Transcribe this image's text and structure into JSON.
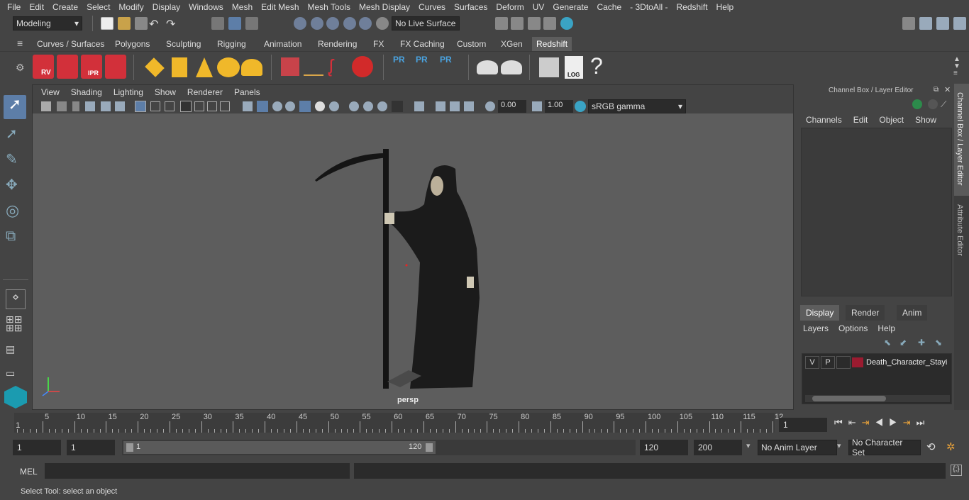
{
  "menubar": [
    "File",
    "Edit",
    "Create",
    "Select",
    "Modify",
    "Display",
    "Windows",
    "Mesh",
    "Edit Mesh",
    "Mesh Tools",
    "Mesh Display",
    "Curves",
    "Surfaces",
    "Deform",
    "UV",
    "Generate",
    "Cache",
    "- 3DtoAll -",
    "Redshift",
    "Help"
  ],
  "status": {
    "mode": "Modeling",
    "live_surface": "No Live Surface"
  },
  "shelf_tabs": [
    "Curves / Surfaces",
    "Polygons",
    "Sculpting",
    "Rigging",
    "Animation",
    "Rendering",
    "FX",
    "FX Caching",
    "Custom",
    "XGen",
    "Redshift"
  ],
  "shelf_active": "Redshift",
  "shelf_labels": {
    "rv": "RV",
    "ipr": "IPR",
    "pr1": "PR",
    "pr2": "PR",
    "pr3": "PR",
    "log": "LOG",
    "help": "?"
  },
  "viewport": {
    "menus": [
      "View",
      "Shading",
      "Lighting",
      "Show",
      "Renderer",
      "Panels"
    ],
    "exposure": "0.00",
    "gamma": "1.00",
    "colorspace": "sRGB gamma",
    "camera": "persp"
  },
  "channelbox": {
    "title": "Channel Box / Layer Editor",
    "menus": [
      "Channels",
      "Edit",
      "Object",
      "Show"
    ]
  },
  "layereditor": {
    "tabs": [
      "Display",
      "Render",
      "Anim"
    ],
    "active_tab": "Display",
    "menus": [
      "Layers",
      "Options",
      "Help"
    ],
    "layer": {
      "v": "V",
      "p": "P",
      "name": "Death_Character_Stayi",
      "color": "#9b1b30"
    }
  },
  "side_tabs": [
    "Channel Box / Layer Editor",
    "Attribute Editor"
  ],
  "timeline": {
    "ticks": [
      "5",
      "10",
      "15",
      "20",
      "25",
      "30",
      "35",
      "40",
      "45",
      "50",
      "55",
      "60",
      "65",
      "70",
      "75",
      "80",
      "85",
      "90",
      "95",
      "100",
      "105",
      "110",
      "115",
      "12"
    ],
    "current_frame": "1",
    "frame_field": "1"
  },
  "range": {
    "start": "1",
    "start2": "1",
    "slider_start": "1",
    "slider_end": "120",
    "end": "120",
    "end2": "200",
    "anim_layer": "No Anim Layer",
    "char_set": "No Character Set"
  },
  "cmdline": {
    "lang": "MEL"
  },
  "helpline": "Select Tool: select an object"
}
